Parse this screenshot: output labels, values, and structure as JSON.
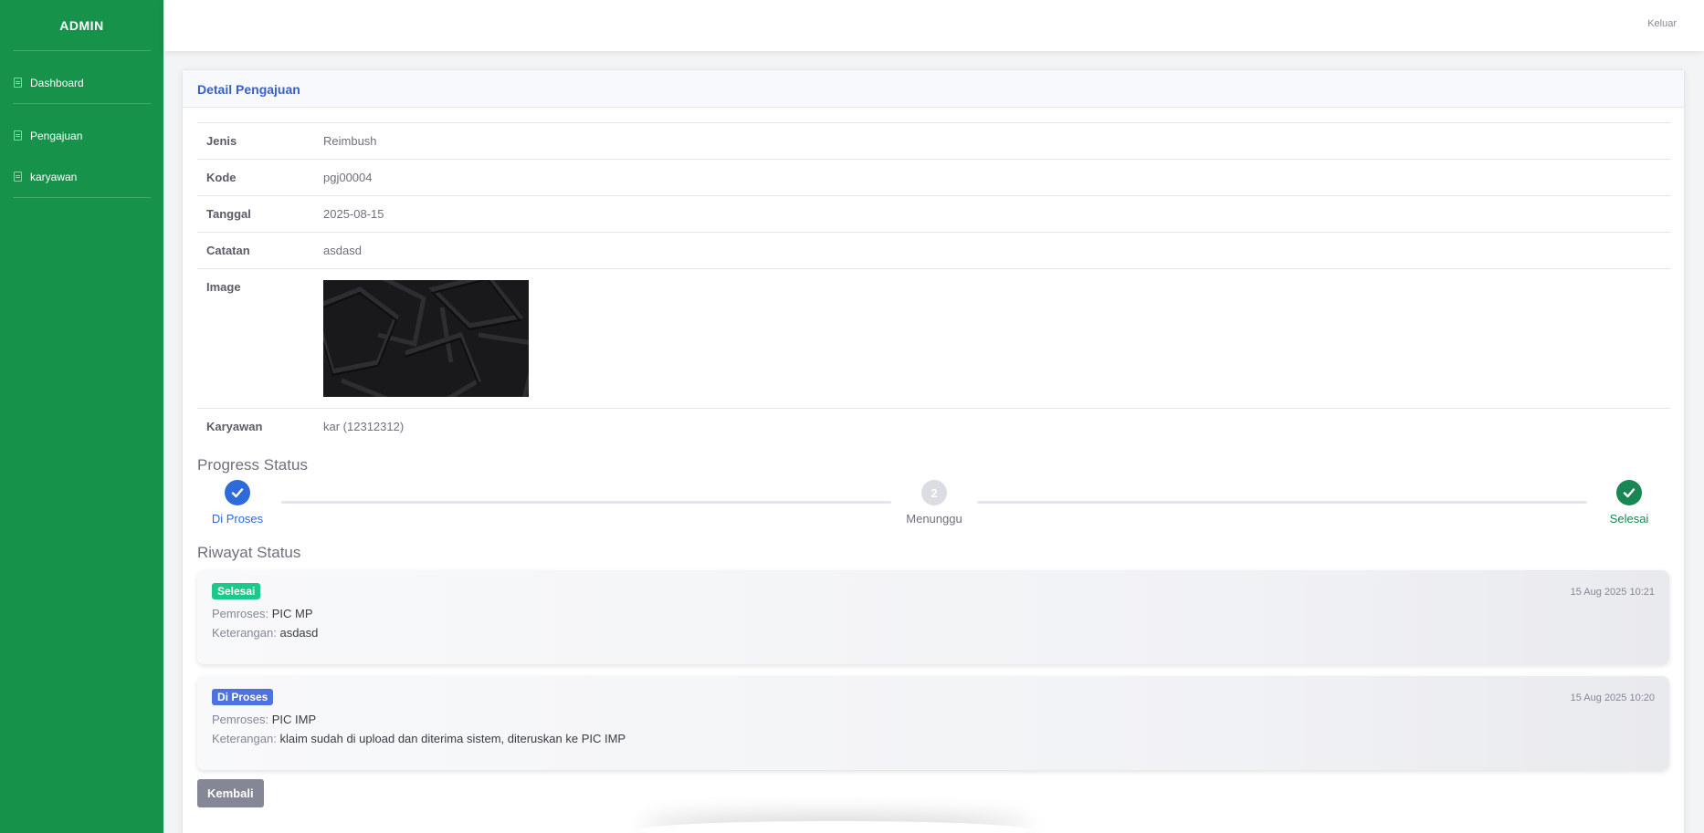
{
  "sidebar": {
    "brand": "ADMIN",
    "items": [
      {
        "label": "Dashboard"
      },
      {
        "label": "Pengajuan"
      },
      {
        "label": "karyawan"
      }
    ]
  },
  "topbar": {
    "logout": "Keluar"
  },
  "card": {
    "title": "Detail Pengajuan",
    "rows": {
      "jenis": {
        "label": "Jenis",
        "value": "Reimbush"
      },
      "kode": {
        "label": "Kode",
        "value": "pgj00004"
      },
      "tanggal": {
        "label": "Tanggal",
        "value": "2025-08-15"
      },
      "catatan": {
        "label": "Catatan",
        "value": "asdasd"
      },
      "image": {
        "label": "Image"
      },
      "karyawan": {
        "label": "Karyawan",
        "value": "kar (12312312)"
      }
    }
  },
  "progress": {
    "title": "Progress Status",
    "steps": [
      {
        "label": "Di Proses",
        "state": "done",
        "color": "#2e6ad9"
      },
      {
        "label": "Menunggu",
        "number": "2",
        "state": "pending",
        "color": "#dcdde2"
      },
      {
        "label": "Selesai",
        "state": "done",
        "color": "#198754"
      }
    ]
  },
  "history": {
    "title": "Riwayat Status",
    "entries": [
      {
        "badge": "Selesai",
        "badge_color": "#1cc88a",
        "timestamp": "15 Aug 2025 10:21",
        "processor_label": "Pemroses:",
        "processor": "PIC MP",
        "note_label": "Keterangan:",
        "note": "asdasd"
      },
      {
        "badge": "Di Proses",
        "badge_color": "#4e73df",
        "timestamp": "15 Aug 2025 10:20",
        "processor_label": "Pemroses:",
        "processor": "PIC IMP",
        "note_label": "Keterangan:",
        "note": "klaim sudah di upload dan diterima sistem, diteruskan ke PIC IMP"
      }
    ]
  },
  "buttons": {
    "back": "Kembali"
  },
  "colors": {
    "sidebar": "#17924a",
    "accent": "#3a5fc8"
  }
}
